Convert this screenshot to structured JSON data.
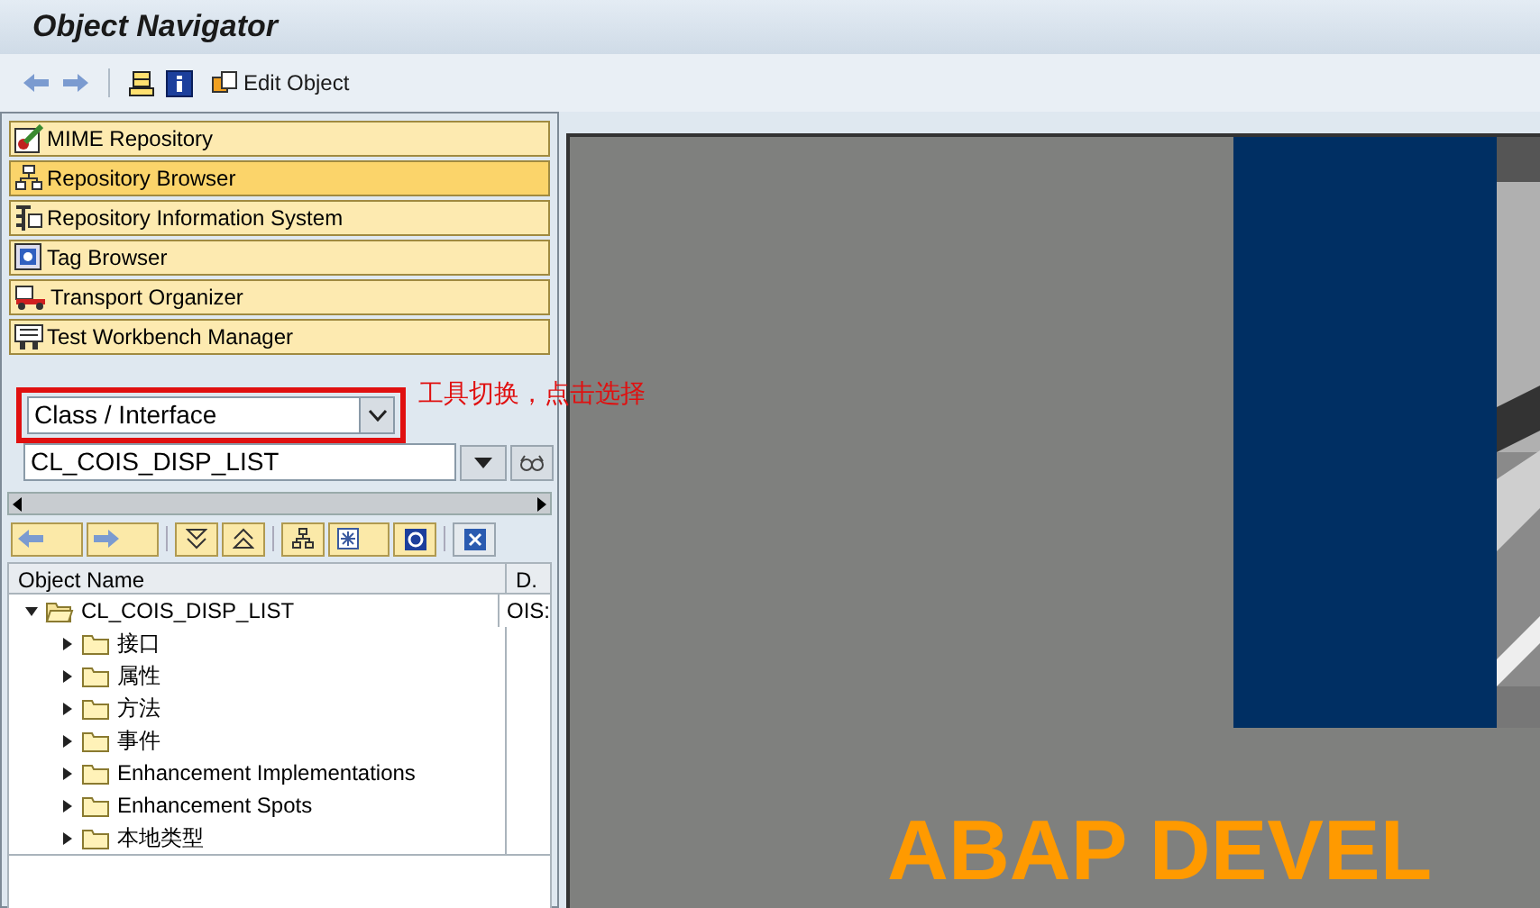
{
  "window": {
    "title": "Object Navigator"
  },
  "toolbar": {
    "edit_object": "Edit Object"
  },
  "tool_buttons": [
    {
      "label": "MIME Repository",
      "kind": "mime",
      "selected": false
    },
    {
      "label": "Repository Browser",
      "kind": "browser",
      "selected": true
    },
    {
      "label": "Repository Information System",
      "kind": "info",
      "selected": false
    },
    {
      "label": "Tag Browser",
      "kind": "tag",
      "selected": false
    },
    {
      "label": "Transport Organizer",
      "kind": "transport",
      "selected": false
    },
    {
      "label": "Test Workbench Manager",
      "kind": "test",
      "selected": false
    }
  ],
  "annotation": "工具切换，点击选择",
  "object_type": {
    "value": "Class / Interface"
  },
  "object_name": {
    "value": "CL_COIS_DISP_LIST"
  },
  "tree": {
    "columns": [
      "Object Name",
      "D."
    ],
    "rows": [
      {
        "name": "CL_COIS_DISP_LIST",
        "description": "OIS:",
        "expanded": true,
        "children": [
          {
            "name": "接口",
            "expanded": false
          },
          {
            "name": "属性",
            "expanded": false
          },
          {
            "name": "方法",
            "expanded": false
          },
          {
            "name": "事件",
            "expanded": false
          },
          {
            "name": "Enhancement Implementations",
            "expanded": false
          },
          {
            "name": "Enhancement Spots",
            "expanded": false
          },
          {
            "name": "本地类型",
            "expanded": false
          }
        ]
      }
    ]
  },
  "splash": {
    "heading": "ABAP DEVEL"
  }
}
